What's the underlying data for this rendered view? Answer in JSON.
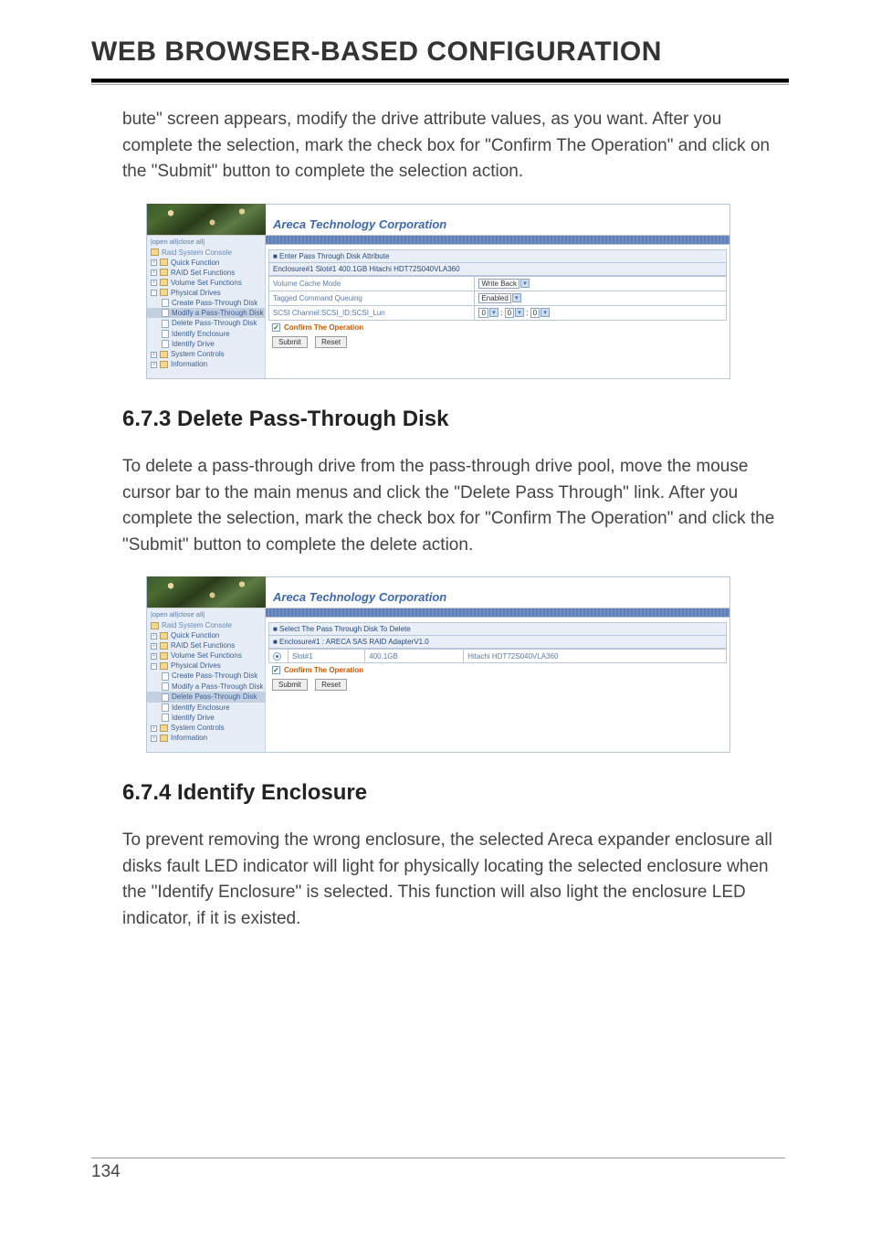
{
  "chapter_title": "WEB BROWSER-BASED CONFIGURATION",
  "intro_paragraph": "bute\" screen appears, modify the drive attribute values, as you want. After you complete the selection, mark the check box for \"Confirm The Operation\" and click on the \"Submit\" button to complete the selection action.",
  "screenshot1": {
    "brand": "Areca Technology Corporation",
    "open_all": "open all",
    "close_all": "close all",
    "tree": {
      "root": "Raid System Console",
      "quick": "Quick Function",
      "raidset": "RAID Set Functions",
      "volume": "Volume Set Functions",
      "phys": "Physical Drives",
      "create": "Create Pass-Through Disk",
      "modify": "Modify a Pass-Through Disk",
      "delete": "Delete Pass-Through Disk",
      "ident_e": "Identify Enclosure",
      "ident_d": "Identify Drive",
      "sys": "System Controls",
      "info": "Information"
    },
    "panel_title": "■ Enter Pass Through Disk Attribute",
    "panel_sub": "Enclosure#1 Slot#1 400.1GB Hitachi HDT72S040VLA360",
    "rows": [
      {
        "label": "Volume Cache Mode",
        "value": "Write Back"
      },
      {
        "label": "Tagged Command Queuing",
        "value": "Enabled"
      },
      {
        "label": "SCSI Channel:SCSI_ID:SCSI_Lun",
        "value_parts": [
          "0",
          "0",
          "0"
        ]
      }
    ],
    "confirm": "Confirm The Operation",
    "submit": "Submit",
    "reset": "Reset"
  },
  "section_673_title": "6.7.3 Delete Pass-Through Disk",
  "section_673_body": "To delete a pass-through drive from the pass-through drive pool, move the mouse cursor bar to the main menus and click the \"Delete Pass Through\" link. After you complete the selection, mark the check box for \"Confirm The Operation\" and click the \"Submit\" button to complete the delete action.",
  "screenshot2": {
    "brand": "Areca Technology Corporation",
    "open_all": "open all",
    "close_all": "close all",
    "tree": {
      "root": "Raid System Console",
      "quick": "Quick Function",
      "raidset": "RAID Set Functions",
      "volume": "Volume Set Functions",
      "phys": "Physical Drives",
      "create": "Create Pass-Through Disk",
      "modify": "Modify a Pass-Through Disk",
      "delete": "Delete Pass-Through Disk",
      "ident_e": "Identify Enclosure",
      "ident_d": "Identify Drive",
      "sys": "System Controls",
      "info": "Information"
    },
    "panel_title": "■ Select The Pass Through Disk To Delete",
    "panel_sub": "■ Enclosure#1 : ARECA SAS RAID AdapterV1.0",
    "row": {
      "slot": "Slot#1",
      "size": "400.1GB",
      "model": "Hitachi HDT72S040VLA360"
    },
    "confirm": "Confirm The Operation",
    "submit": "Submit",
    "reset": "Reset"
  },
  "section_674_title": "6.7.4 Identify Enclosure",
  "section_674_body": "To prevent removing the wrong enclosure, the selected Areca expander enclosure all disks fault LED indicator will light for physically locating the selected enclosure when the \"Identify Enclosure\" is selected. This function will also light the enclosure LED indicator, if it is existed.",
  "page_number": "134"
}
